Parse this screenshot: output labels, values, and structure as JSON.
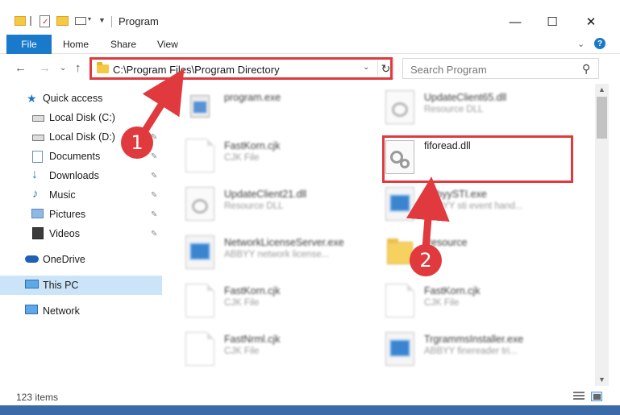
{
  "window": {
    "title": "Program",
    "minimize_glyph": "—",
    "maximize_glyph": "☐",
    "close_glyph": "✕"
  },
  "ribbon": {
    "tabs": [
      "File",
      "Home",
      "Share",
      "View"
    ],
    "collapse_glyph": "⌄",
    "help_glyph": "?"
  },
  "nav": {
    "back_glyph": "←",
    "forward_glyph": "→",
    "recent_glyph": "⌄",
    "up_glyph": "↑",
    "address": "C:\\Program Files\\Program Directory",
    "address_dropdown_glyph": "⌄",
    "refresh_glyph": "↻",
    "search_placeholder": "Search Program",
    "search_icon_glyph": "⚲"
  },
  "sidebar": {
    "items": [
      {
        "label": "Quick access",
        "icon": "star-icon",
        "pinned": false
      },
      {
        "label": "Local Disk (C:)",
        "icon": "drive-icon",
        "pinned": true
      },
      {
        "label": "Local Disk (D:)",
        "icon": "drive-icon",
        "pinned": true
      },
      {
        "label": "Documents",
        "icon": "documents-icon",
        "pinned": true
      },
      {
        "label": "Downloads",
        "icon": "download-icon",
        "pinned": true
      },
      {
        "label": "Music",
        "icon": "music-icon",
        "pinned": true
      },
      {
        "label": "Pictures",
        "icon": "pictures-icon",
        "pinned": true
      },
      {
        "label": "Videos",
        "icon": "videos-icon",
        "pinned": true
      },
      {
        "label": "OneDrive",
        "icon": "cloud-icon",
        "pinned": false
      },
      {
        "label": "This PC",
        "icon": "pc-icon",
        "pinned": false,
        "selected": true
      },
      {
        "label": "Network",
        "icon": "network-icon",
        "pinned": false
      }
    ],
    "pin_glyph": "📌"
  },
  "files": [
    {
      "name": "program.exe",
      "type": "",
      "icon": "exe-icon"
    },
    {
      "name": "UpdateClient65.dll",
      "type": "Resource DLL",
      "icon": "dll-icon"
    },
    {
      "name": "FastKorn.cjk",
      "type": "CJK File",
      "icon": "doc-icon"
    },
    {
      "name": "fiforead.dll",
      "type": "",
      "icon": "dll-icon"
    },
    {
      "name": "UpdateClient21.dll",
      "type": "Resource DLL",
      "icon": "dll-icon"
    },
    {
      "name": "AbbyySTI.exe",
      "type": "ABBYY sti event hand...",
      "icon": "exe-icon"
    },
    {
      "name": "NetworkLicenseServer.exe",
      "type": "ABBYY network license...",
      "icon": "exe-icon"
    },
    {
      "name": "Resource",
      "type": "",
      "icon": "folder-icon"
    },
    {
      "name": "FastKorn.cjk",
      "type": "CJK File",
      "icon": "doc-icon"
    },
    {
      "name": "FastKorn.cjk",
      "type": "CJK File",
      "icon": "doc-icon"
    },
    {
      "name": "FastNrml.cjk",
      "type": "CJK File",
      "icon": "doc-icon"
    },
    {
      "name": "TrgrammsInstaller.exe",
      "type": "ABBYY finereader tri...",
      "icon": "exe-icon"
    }
  ],
  "status": {
    "count": "123 items"
  },
  "annotations": {
    "step1": "1",
    "step2": "2",
    "accent": "#e0393e"
  },
  "colors": {
    "file_tab": "#1979ca",
    "selection": "#cce4f7",
    "annotation": "#e0393e"
  }
}
